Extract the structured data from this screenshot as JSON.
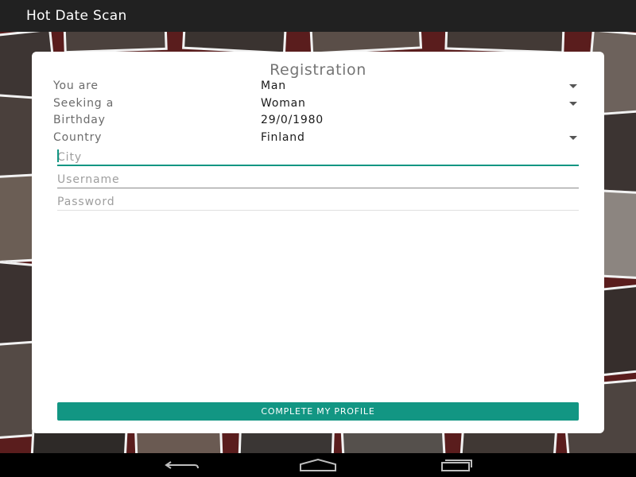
{
  "app": {
    "title": "Hot Date Scan"
  },
  "card": {
    "title": "Registration"
  },
  "rows": [
    {
      "label": "You are",
      "value": "Man",
      "dropdown": true
    },
    {
      "label": "Seeking a",
      "value": "Woman",
      "dropdown": true
    },
    {
      "label": "Birthday",
      "value": "29/0/1980",
      "dropdown": false
    },
    {
      "label": "Country",
      "value": "Finland",
      "dropdown": true
    }
  ],
  "fields": {
    "city": {
      "placeholder": "City",
      "value": ""
    },
    "username": {
      "placeholder": "Username",
      "value": ""
    },
    "password": {
      "placeholder": "Password",
      "value": ""
    }
  },
  "submit": {
    "label": "COMPLETE MY PROFILE"
  },
  "nav": {
    "back_icon": "back-icon",
    "home_icon": "home-icon",
    "recents_icon": "recents-icon"
  },
  "colors": {
    "accent": "#129683",
    "action_bar": "#212121",
    "backdrop": "#5a1d1d"
  }
}
